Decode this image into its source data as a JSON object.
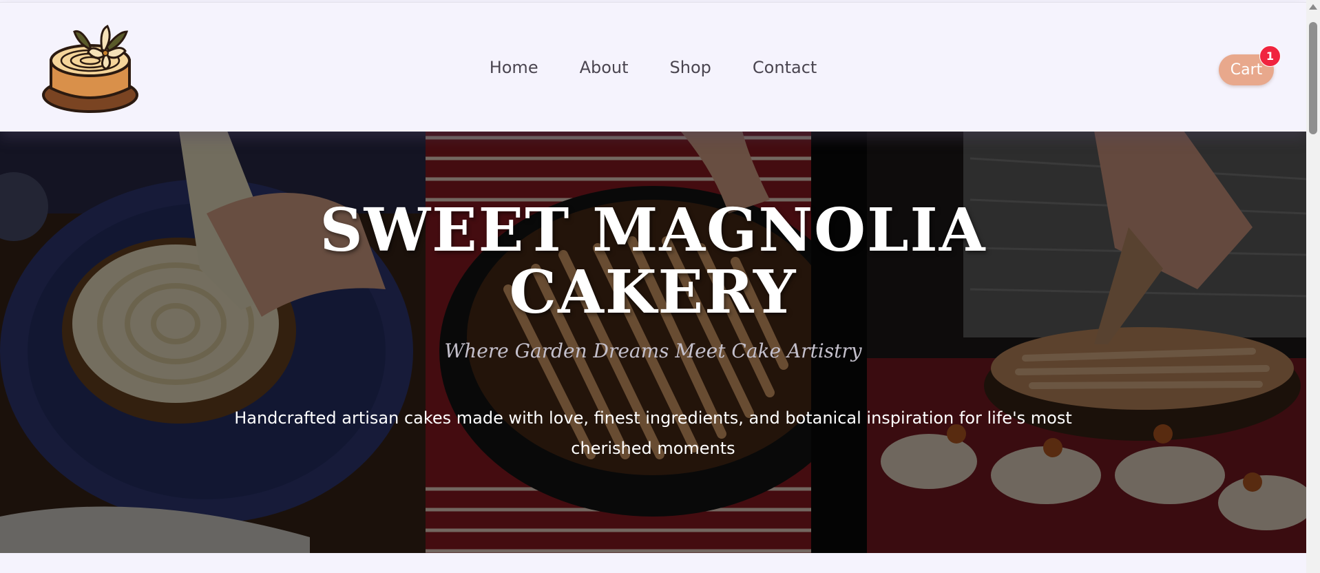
{
  "header": {
    "logo_alt": "Sweet Magnolia Cakery logo",
    "nav": [
      {
        "label": "Home"
      },
      {
        "label": "About"
      },
      {
        "label": "Shop"
      },
      {
        "label": "Contact"
      }
    ],
    "cart_label": "Cart",
    "cart_count": "1"
  },
  "hero": {
    "title_line1": "SWEET MAGNOLIA",
    "title_line2": "CAKERY",
    "tagline": "Where Garden Dreams Meet Cake Artistry",
    "description_line1": "Handcrafted artisan cakes made with love, finest ingredients, and botanical inspiration for life's most",
    "description_line2": "cherished moments"
  },
  "colors": {
    "page_background": "#f5f3fd",
    "cart_button": "#e8a88c",
    "cart_badge": "#f0243f",
    "hero_overlay": "rgba(0,0,0,0.52)"
  },
  "icons": {
    "logo": "cake-with-flower-icon",
    "scroll_up": "scroll-up-arrow-icon"
  }
}
